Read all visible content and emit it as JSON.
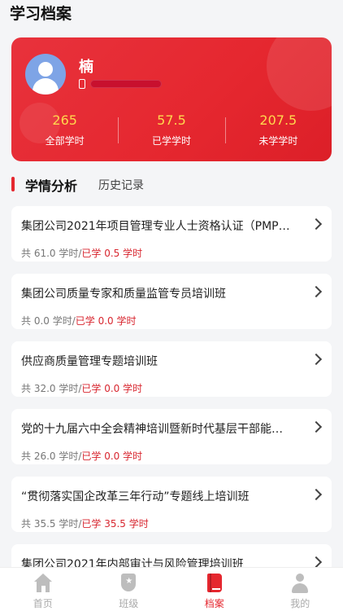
{
  "header": {
    "title": "学习档案"
  },
  "profile": {
    "name": "楠",
    "stats": [
      {
        "value": "265",
        "label": "全部学时"
      },
      {
        "value": "57.5",
        "label": "已学学时"
      },
      {
        "value": "207.5",
        "label": "未学学时"
      }
    ]
  },
  "section": {
    "active_tab": "学情分析",
    "other_tab": "历史记录"
  },
  "courses": [
    {
      "title": "集团公司2021年项目管理专业人士资格认证（PMP…",
      "total": "共 61.0 学时/",
      "done": "已学 0.5 学时"
    },
    {
      "title": "集团公司质量专家和质量监管专员培训班",
      "total": "共 0.0 学时/",
      "done": "已学 0.0 学时"
    },
    {
      "title": "供应商质量管理专题培训班",
      "total": "共 32.0 学时/",
      "done": "已学 0.0 学时"
    },
    {
      "title": "党的十九届六中全会精神培训暨新时代基层干部能…",
      "total": "共 26.0 学时/",
      "done": "已学 0.0 学时"
    },
    {
      "title": "“贯彻落实国企改革三年行动”专题线上培训班",
      "total": "共 35.5 学时/",
      "done": "已学 35.5 学时"
    },
    {
      "title": "集团公司2021年内部审计与风险管理培训班",
      "total": "",
      "done": ""
    }
  ],
  "tabbar": {
    "items": [
      {
        "label": "首页",
        "icon": "home-icon"
      },
      {
        "label": "班级",
        "icon": "class-badge-icon"
      },
      {
        "label": "档案",
        "icon": "archive-book-icon"
      },
      {
        "label": "我的",
        "icon": "user-icon"
      }
    ],
    "active_index": 2
  },
  "colors": {
    "accent": "#e5272f",
    "stat_number": "#ffd84d",
    "done_text": "#d8262f",
    "background": "#f4f5f7"
  }
}
